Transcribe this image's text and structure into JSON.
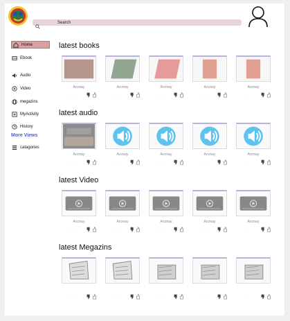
{
  "search": {
    "label": "Search"
  },
  "sidebar": {
    "items": [
      {
        "label": "Home",
        "icon": "home-icon"
      },
      {
        "label": "Ebook",
        "icon": "book-icon"
      },
      {
        "label": "Audio",
        "icon": "speaker-icon"
      },
      {
        "label": "Video",
        "icon": "play-circle-icon"
      },
      {
        "label": "megazins",
        "icon": "globe-icon"
      },
      {
        "label": "MyActivity",
        "icon": "list-icon"
      },
      {
        "label": "History",
        "icon": "clock-icon"
      }
    ],
    "more_views": "More Views",
    "categories": "catagories"
  },
  "sections": [
    {
      "title": "latest books",
      "kind": "book",
      "authors": [
        "Arcmay",
        "Arcmay",
        "Arcmay",
        "Arcmay",
        "Arcmay"
      ]
    },
    {
      "title": "latest audio",
      "kind": "audio",
      "authors": [
        "Arcmay",
        "Arcmay",
        "Arcmay",
        "Arcmay",
        "Arcmay"
      ]
    },
    {
      "title": "latest Video",
      "kind": "video",
      "authors": [
        "Arcmay",
        "Arcmay",
        "Arcmay",
        "Arcmay",
        "Arcmay"
      ]
    },
    {
      "title": "latest Megazins",
      "kind": "magazine",
      "authors": [
        "",
        "",
        "",
        "",
        ""
      ]
    }
  ],
  "colors": {
    "accent": "#4a5fc8",
    "search_bg": "#e8d4d4",
    "active_bg": "#d8a0a0",
    "audio": "#5ec3ef"
  }
}
